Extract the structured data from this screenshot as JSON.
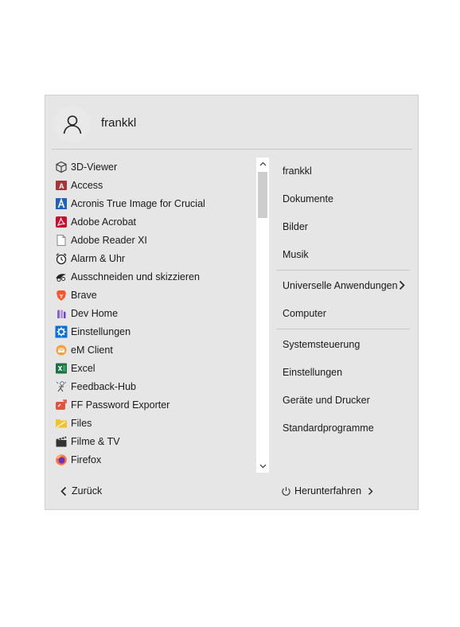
{
  "user": {
    "name": "frankkl",
    "avatar_icon": "user-icon"
  },
  "apps": [
    {
      "label": "3D-Viewer",
      "icon": "cube-icon"
    },
    {
      "label": "Access",
      "icon": "access-icon"
    },
    {
      "label": "Acronis True Image for Crucial",
      "icon": "acronis-icon"
    },
    {
      "label": "Adobe Acrobat",
      "icon": "acrobat-icon"
    },
    {
      "label": "Adobe Reader XI",
      "icon": "document-icon"
    },
    {
      "label": "Alarm & Uhr",
      "icon": "alarm-clock-icon"
    },
    {
      "label": "Ausschneiden und skizzieren",
      "icon": "snip-icon"
    },
    {
      "label": "Brave",
      "icon": "brave-lion-icon"
    },
    {
      "label": "Dev Home",
      "icon": "dev-home-icon"
    },
    {
      "label": "Einstellungen",
      "icon": "gear-icon"
    },
    {
      "label": "eM Client",
      "icon": "mail-icon"
    },
    {
      "label": "Excel",
      "icon": "excel-icon"
    },
    {
      "label": "Feedback-Hub",
      "icon": "feedback-icon"
    },
    {
      "label": "FF Password Exporter",
      "icon": "export-icon"
    },
    {
      "label": "Files",
      "icon": "folder-icon"
    },
    {
      "label": "Filme & TV",
      "icon": "clapperboard-icon"
    },
    {
      "label": "Firefox",
      "icon": "firefox-icon"
    }
  ],
  "right_panel": {
    "items": [
      {
        "label": "frankkl"
      },
      {
        "label": "Dokumente"
      },
      {
        "label": "Bilder"
      },
      {
        "label": "Musik"
      },
      {
        "label": "Universelle Anwendungen",
        "has_submenu": true
      },
      {
        "label": "Computer"
      },
      {
        "label": "Systemsteuerung"
      },
      {
        "label": "Einstellungen"
      },
      {
        "label": "Geräte und Drucker"
      },
      {
        "label": "Standardprogramme"
      }
    ]
  },
  "footer": {
    "back_label": "Zurück",
    "shutdown_label": "Herunterfahren"
  },
  "colors": {
    "menu_bg": "#e6e6e6",
    "divider": "#c8c8c8",
    "scroll_thumb": "#cdcdcd"
  }
}
